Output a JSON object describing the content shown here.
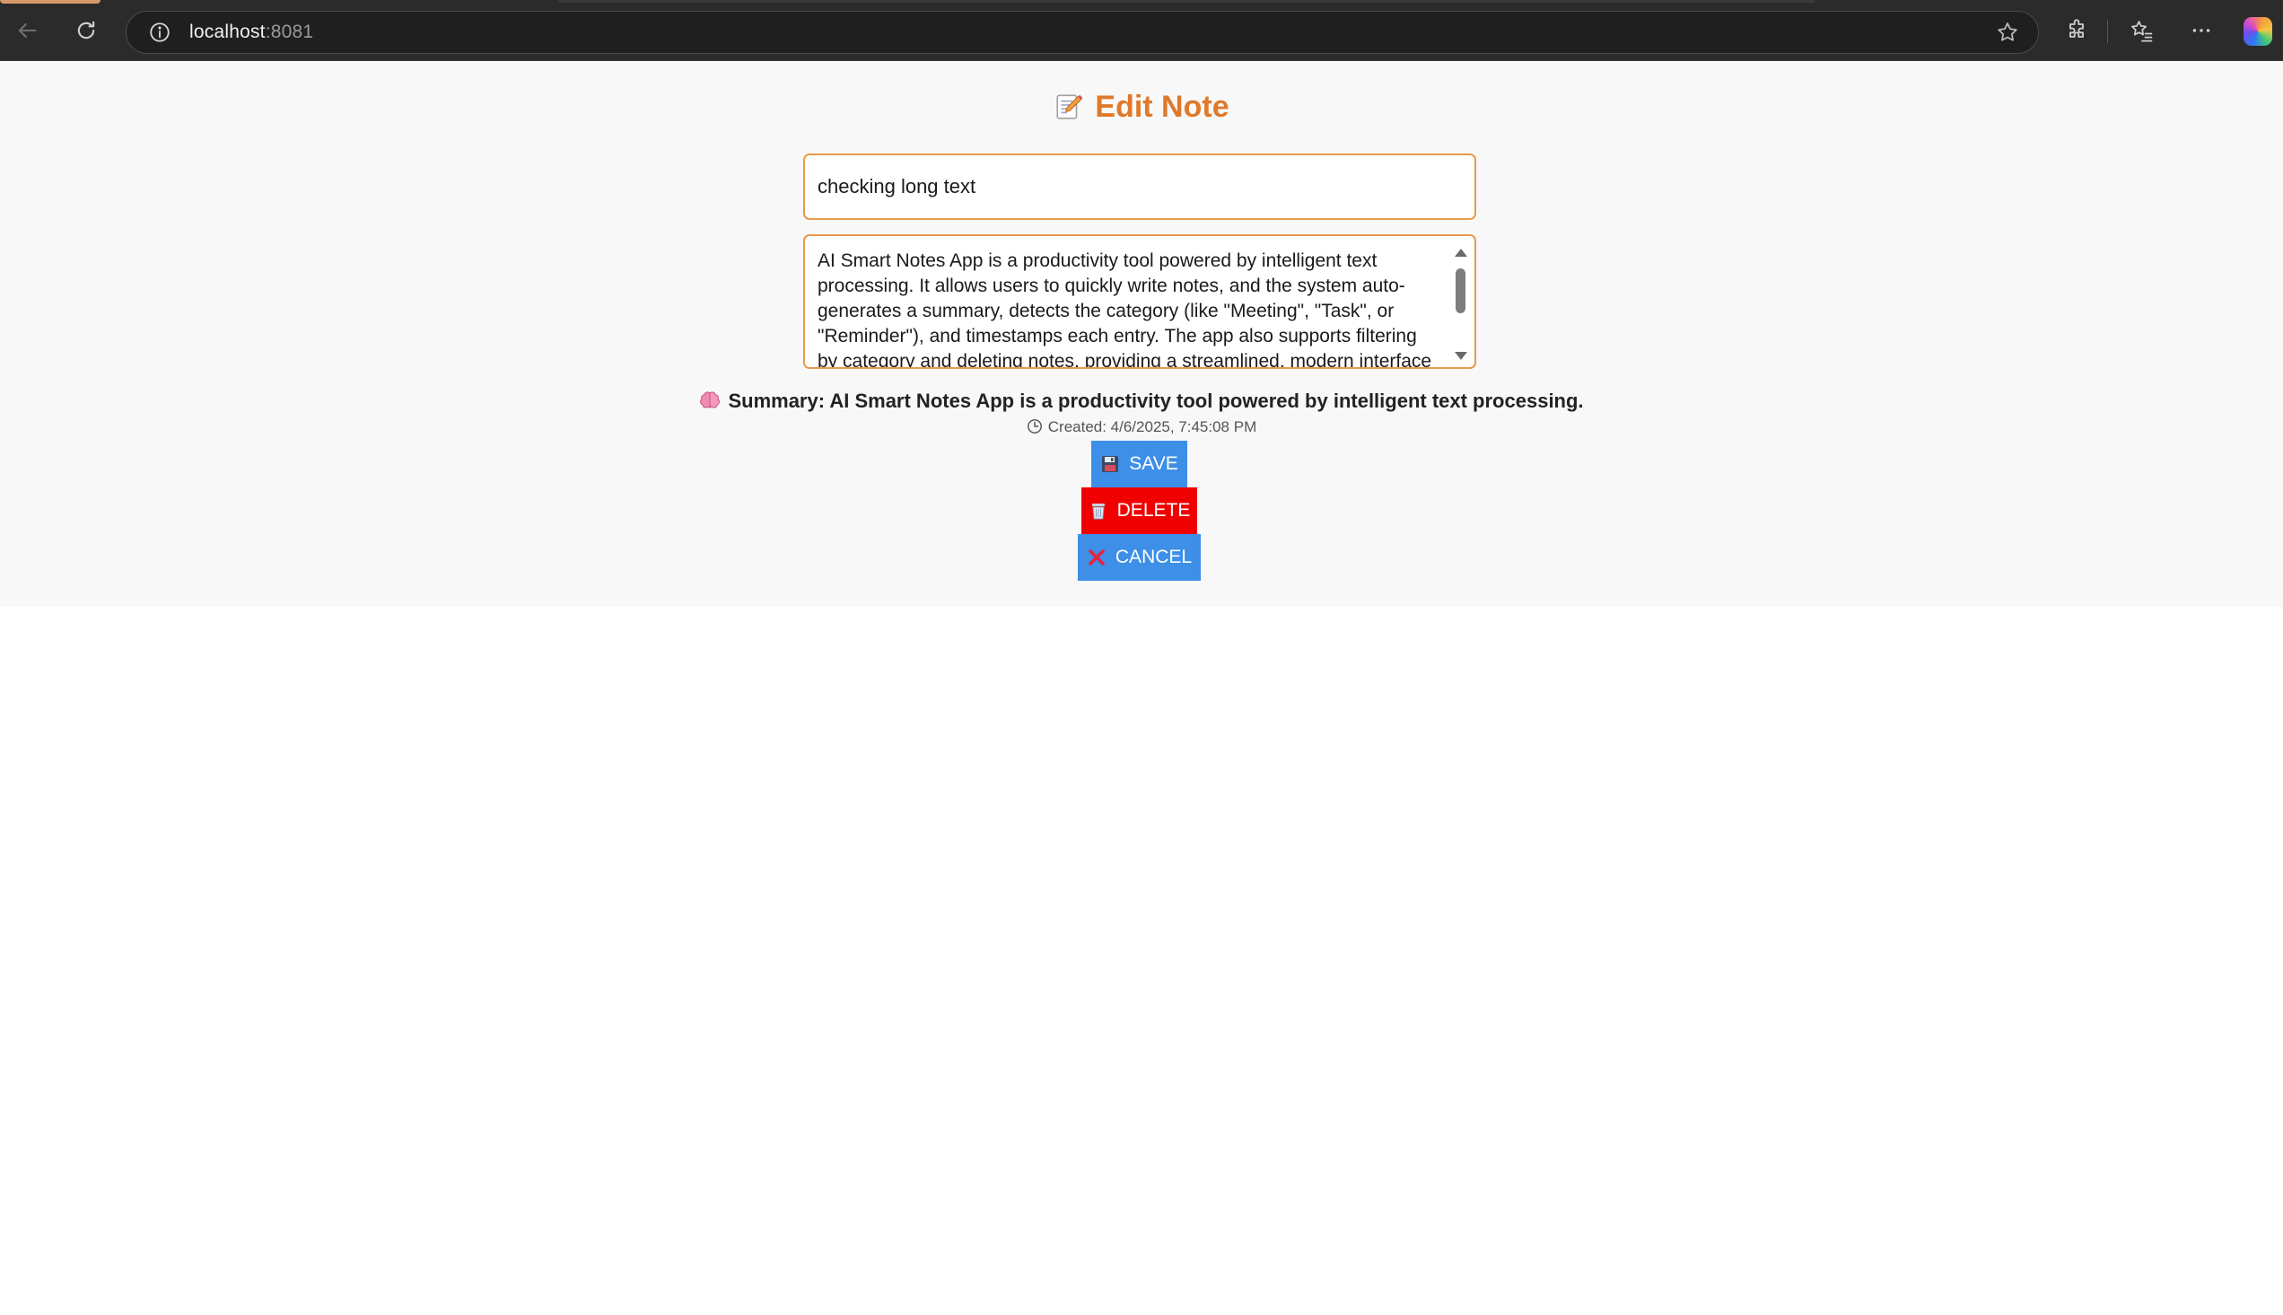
{
  "browser": {
    "url_host": "localhost",
    "url_port": ":8081"
  },
  "page": {
    "title": "Edit Note",
    "title_icon": "memo-emoji",
    "note_title_value": "checking long text",
    "note_body_value": "AI Smart Notes App is a productivity tool powered by intelligent text processing. It allows users to quickly write notes, and the system auto-generates a summary, detects the category (like \"Meeting\", \"Task\", or \"Reminder\"), and timestamps each entry. The app also supports filtering by category and deleting notes, providing a streamlined, modern interface",
    "summary_label": "Summary: AI Smart Notes App is a productivity tool powered by intelligent text processing.",
    "created_label": "Created: 4/6/2025, 7:45:08 PM",
    "buttons": {
      "save": "SAVE",
      "delete": "DELETE",
      "cancel": "CANCEL"
    }
  },
  "colors": {
    "title": "#e0792a",
    "input_border": "#e89a4c",
    "save_bg": "#3d8fe8",
    "delete_bg": "#f00000",
    "cancel_bg": "#3d8fe8"
  }
}
